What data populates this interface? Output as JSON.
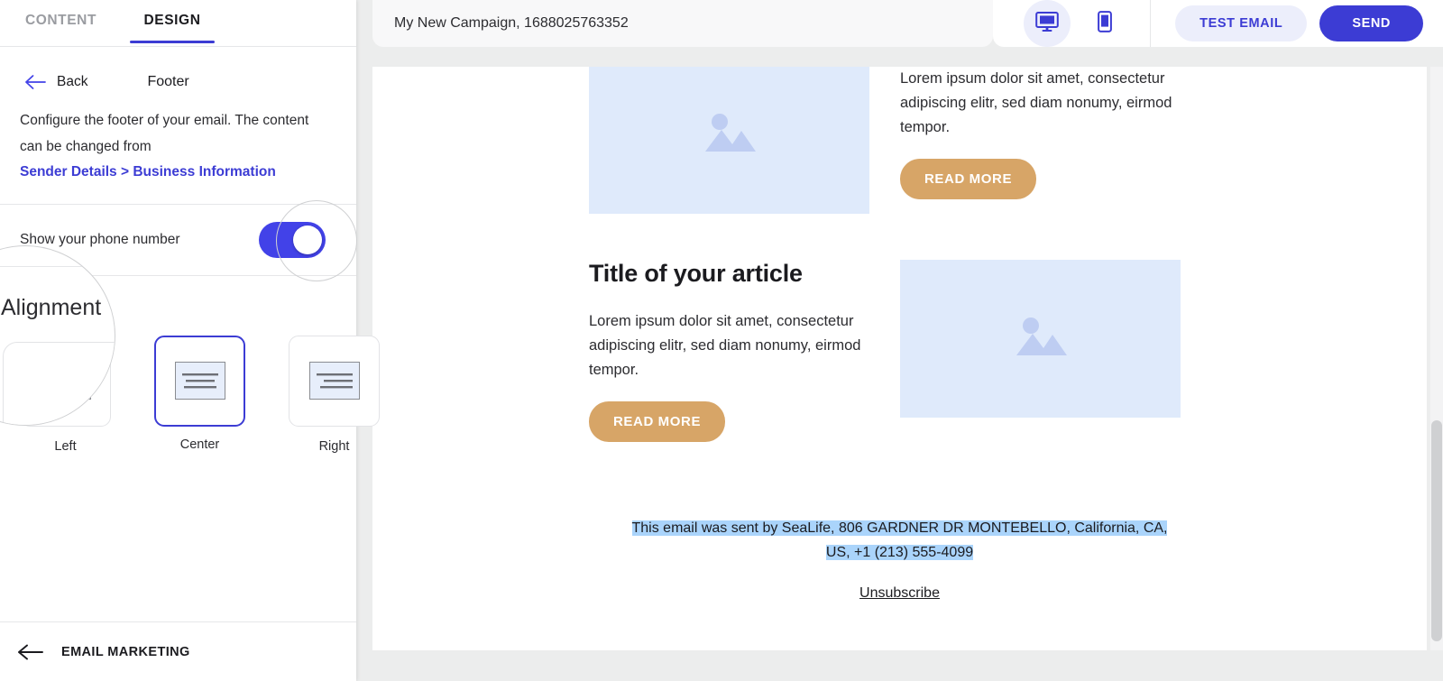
{
  "sidebar": {
    "tabs": [
      {
        "label": "CONTENT",
        "active": false
      },
      {
        "label": "DESIGN",
        "active": true
      }
    ],
    "back_label": "Back",
    "panel_title": "Footer",
    "description_line1": "Configure the footer of your email. The",
    "description_line2": "content can be changed from",
    "link_label": "Sender Details > Business Information",
    "toggle": {
      "label": "Show your phone number",
      "state": "on"
    },
    "alignment": {
      "title": "Alignment",
      "selected": "Center",
      "options": [
        {
          "label": "Left"
        },
        {
          "label": "Center"
        },
        {
          "label": "Right"
        }
      ]
    },
    "bottom_bar_label": "EMAIL MARKETING"
  },
  "magnifier": {
    "alignment_zoom_text": "Alignment"
  },
  "topbar": {
    "campaign_name": "My New Campaign, 1688025763352",
    "view_modes": [
      {
        "name": "desktop-preview",
        "active": true
      },
      {
        "name": "mobile-preview",
        "active": false
      }
    ],
    "test_email_label": "TEST EMAIL",
    "send_label": "SEND"
  },
  "email": {
    "article1": {
      "body": "Lorem ipsum dolor sit amet, consectetur adipiscing elitr, sed diam nonumy, eirmod tempor.",
      "cta": "READ MORE"
    },
    "article2": {
      "title": "Title of your article",
      "body": "Lorem ipsum dolor sit amet, consectetur adipiscing elitr, sed diam nonumy, eirmod tempor.",
      "cta": "READ MORE"
    },
    "footer": {
      "sent_by_line1": "This email was sent by SeaLife, 806 GARDNER DR MONTEBELLO, California, CA,",
      "sent_by_line2": "US, +1 (213) 555-4099",
      "unsubscribe_label": "Unsubscribe"
    }
  },
  "colors": {
    "accent": "#3c3cd4",
    "toggle_on": "#4242e8",
    "cta": "#d7a567",
    "image_placeholder": "#dfeafb",
    "selection_highlight": "#aad4fb"
  }
}
